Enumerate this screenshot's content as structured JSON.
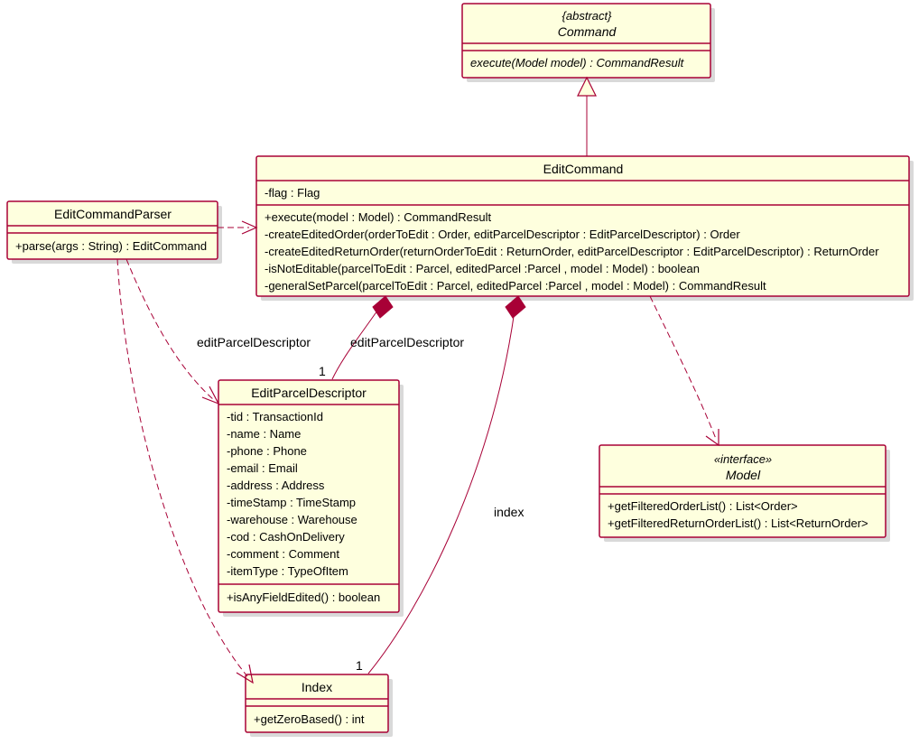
{
  "command": {
    "stereo": "{abstract}",
    "name": "Command",
    "methods": [
      "execute(Model model) : CommandResult"
    ]
  },
  "editCommand": {
    "name": "EditCommand",
    "fields": [
      "-flag : Flag"
    ],
    "methods": [
      "+execute(model : Model) : CommandResult",
      "-createEditedOrder(orderToEdit : Order, editParcelDescriptor : EditParcelDescriptor) : Order",
      "-createEditedReturnOrder(returnOrderToEdit : ReturnOrder, editParcelDescriptor : EditParcelDescriptor) : ReturnOrder",
      "-isNotEditable(parcelToEdit : Parcel, editedParcel :Parcel , model : Model) : boolean",
      "-generalSetParcel(parcelToEdit : Parcel, editedParcel :Parcel , model : Model) : CommandResult"
    ]
  },
  "editCommandParser": {
    "name": "EditCommandParser",
    "methods": [
      "+parse(args : String) : EditCommand"
    ]
  },
  "editParcelDescriptor": {
    "name": "EditParcelDescriptor",
    "fields": [
      "-tid : TransactionId",
      "-name : Name",
      "-phone : Phone",
      "-email : Email",
      "-address : Address",
      "-timeStamp : TimeStamp",
      "-warehouse : Warehouse",
      "-cod : CashOnDelivery",
      "-comment : Comment",
      "-itemType : TypeOfItem"
    ],
    "methods": [
      "+isAnyFieldEdited() : boolean"
    ]
  },
  "model": {
    "stereo": "«interface»",
    "name": "Model",
    "methods": [
      "+getFilteredOrderList() : List<Order>",
      "+getFilteredReturnOrderList() : List<ReturnOrder>"
    ]
  },
  "index": {
    "name": "Index",
    "methods": [
      "+getZeroBased() : int"
    ]
  },
  "labels": {
    "epd1": "editParcelDescriptor",
    "epd2": "editParcelDescriptor",
    "epdMult": "1",
    "indexLabel": "index",
    "indexMult": "1"
  }
}
